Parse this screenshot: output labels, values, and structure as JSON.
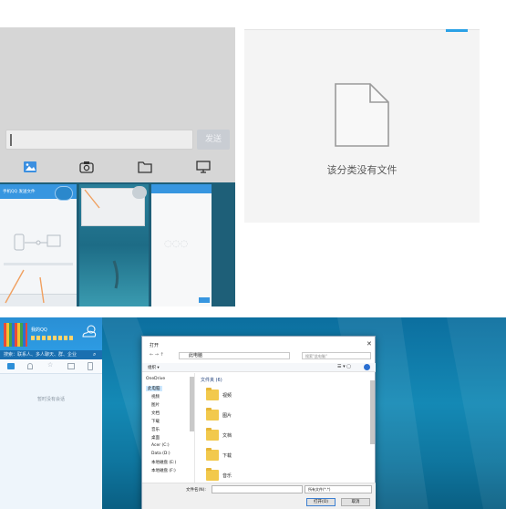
{
  "phone_chat": {
    "input_value": "",
    "send_label": "发送",
    "tools": [
      {
        "icon": "picture-icon"
      },
      {
        "icon": "camera-icon"
      },
      {
        "icon": "folder-icon"
      },
      {
        "icon": "monitor-icon"
      }
    ],
    "thumbnails": [
      {
        "title": "手机QQ 发送文件"
      },
      {
        "title": ""
      },
      {
        "title": ""
      }
    ],
    "arrow_color": "#f0a060"
  },
  "file_panel": {
    "empty_message": "该分类没有文件",
    "accent_color": "#2aa1e6"
  },
  "desktop": {
    "qq_panel": {
      "name": "我的QQ",
      "search_placeholder": "搜索：联系人、多人聊天、群、企业",
      "empty_text": "暂时没有会话"
    },
    "open_dialog": {
      "title": "打开",
      "address": "此电脑",
      "search_placeholder": "搜索\"此电脑\"",
      "toolbar_label": "组织 ▾",
      "nav_items": [
        "OneDrive",
        "此电脑",
        "视频",
        "图片",
        "文档",
        "下载",
        "音乐",
        "桌面",
        "Acer (C:)",
        "Data (D:)",
        "本地磁盘 (E:)",
        "本地磁盘 (F:)"
      ],
      "section_header": "文件夹 (6)",
      "folders": [
        "视频",
        "图片",
        "文档",
        "下载",
        "音乐"
      ],
      "filename_label": "文件名(N):",
      "filetype_value": "所有文件(*.*)",
      "open_label": "打开(O)",
      "cancel_label": "取消"
    }
  }
}
